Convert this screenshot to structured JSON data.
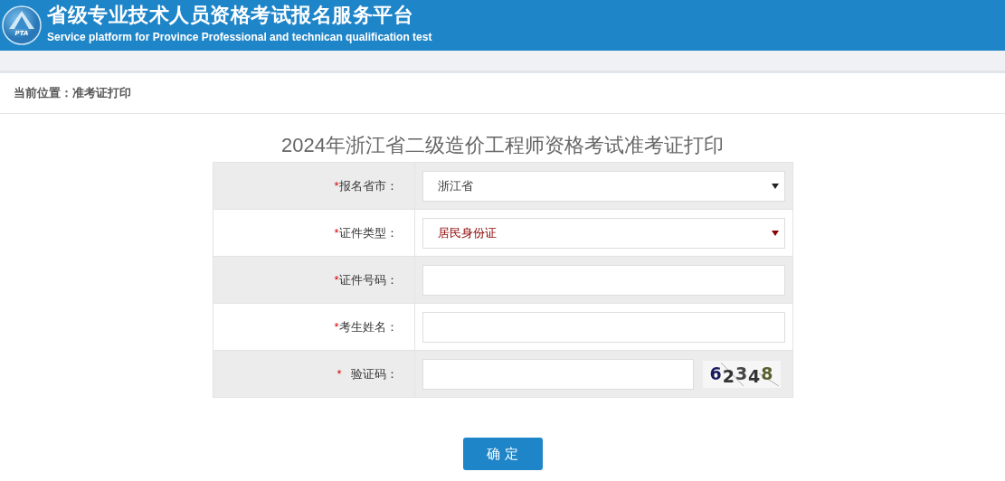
{
  "header": {
    "logo_text": "PTA",
    "title": "省级专业技术人员资格考试报名服务平台",
    "subtitle": "Service platform for Province Professional and technican qualification test"
  },
  "breadcrumb": "当前位置：准考证打印",
  "form": {
    "title": "2024年浙江省二级造价工程师资格考试准考证打印",
    "rows": [
      {
        "kind": "select",
        "required_mark": "*",
        "label": "报名省市：",
        "value": "浙江省",
        "highlighted": false
      },
      {
        "kind": "select",
        "required_mark": "*",
        "label": "证件类型：",
        "value": "居民身份证",
        "highlighted": true
      },
      {
        "kind": "input",
        "required_mark": "*",
        "label": "证件号码："
      },
      {
        "kind": "input",
        "required_mark": "*",
        "label": "考生姓名："
      },
      {
        "kind": "captcha",
        "required_mark": "*",
        "label": "验证码：",
        "captcha": "62348"
      }
    ]
  },
  "submit": "确 定"
}
